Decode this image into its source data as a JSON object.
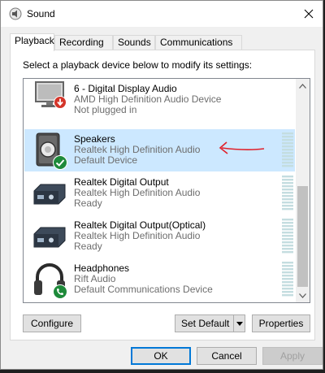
{
  "window": {
    "title": "Sound",
    "icons": {
      "app": "speaker-icon",
      "close": "close-icon"
    }
  },
  "tabs": [
    {
      "label": "Playback",
      "active": true
    },
    {
      "label": "Recording",
      "active": false
    },
    {
      "label": "Sounds",
      "active": false
    },
    {
      "label": "Communications",
      "active": false
    }
  ],
  "playback": {
    "instruction": "Select a playback device below to modify its settings:",
    "devices": [
      {
        "name": "6 - Digital Display Audio",
        "driver": "AMD High Definition Audio Device",
        "status": "Not plugged in",
        "icon": "monitor-icon",
        "badge": "unplugged-badge-icon",
        "selected": false
      },
      {
        "name": "Speakers",
        "driver": "Realtek High Definition Audio",
        "status": "Default Device",
        "icon": "speaker-device-icon",
        "badge": "default-check-badge-icon",
        "selected": true
      },
      {
        "name": "Realtek Digital Output",
        "driver": "Realtek High Definition Audio",
        "status": "Ready",
        "icon": "digital-output-icon",
        "badge": "",
        "selected": false
      },
      {
        "name": "Realtek Digital Output(Optical)",
        "driver": "Realtek High Definition Audio",
        "status": "Ready",
        "icon": "digital-output-icon",
        "badge": "",
        "selected": false
      },
      {
        "name": "Headphones",
        "driver": "Rift Audio",
        "status": "Default Communications Device",
        "icon": "headphones-icon",
        "badge": "communications-phone-badge-icon",
        "selected": false
      }
    ],
    "configure_label": "Configure",
    "set_default_label": "Set Default",
    "properties_label": "Properties"
  },
  "footer": {
    "ok_label": "OK",
    "cancel_label": "Cancel",
    "apply_label": "Apply"
  },
  "colors": {
    "selection": "#cce8ff",
    "accent": "#0078d7",
    "annotation": "#e0202a",
    "check_badge": "#1e8a3a",
    "unplugged_badge": "#d4352a"
  }
}
